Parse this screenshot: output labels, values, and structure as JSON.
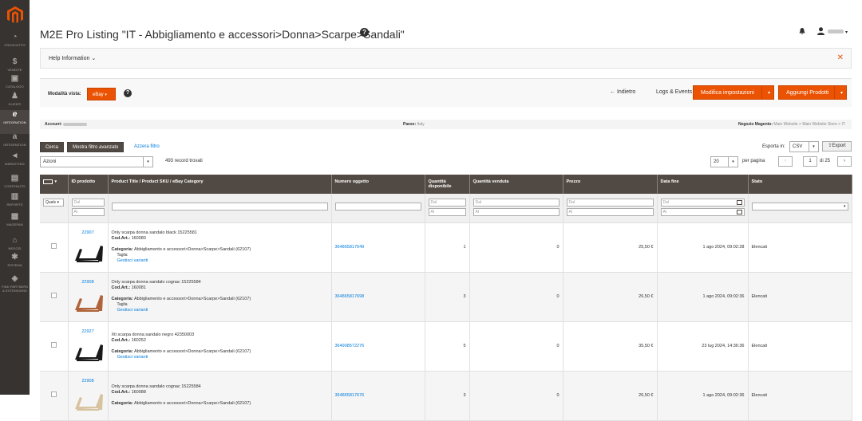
{
  "sidebar": {
    "items": [
      {
        "label": "CRUSCOTTO",
        "icon": "dashboard-icon"
      },
      {
        "label": "VENDITE",
        "icon": "dollar-icon"
      },
      {
        "label": "CATALOGO",
        "icon": "box-icon"
      },
      {
        "label": "CLIENTI",
        "icon": "person-icon"
      },
      {
        "label": "INTEGRATION",
        "icon": "ebay-icon"
      },
      {
        "label": "INTEGRATION",
        "icon": "amazon-icon"
      },
      {
        "label": "MARKETING",
        "icon": "megaphone-icon"
      },
      {
        "label": "CONTENUTO",
        "icon": "content-icon"
      },
      {
        "label": "REPORTS",
        "icon": "bar-chart-icon"
      },
      {
        "label": "MAGEFAN",
        "icon": "magefan-icon"
      },
      {
        "label": "NEGOZI",
        "icon": "store-icon"
      },
      {
        "label": "SISTEMA",
        "icon": "gear-icon"
      },
      {
        "label": "FIND PARTNERS & EXTENSIONS",
        "icon": "blocks-icon"
      }
    ],
    "logo_color": "#eb5202"
  },
  "header": {
    "title": "M2E Pro Listing \"IT - Abbigliamento e accessori>Donna>Scarpe>Sandali\"",
    "help_icon": "?"
  },
  "help_bar": {
    "label": "Help Information",
    "close": "✕"
  },
  "toolbar": {
    "mode_label": "Modalità vista:",
    "mode_value": "eBay",
    "back": "Indietro",
    "logs": "Logs & Events",
    "edit_settings": "Modifica impostazioni",
    "add_products": "Aggiungi Prodotti"
  },
  "info": {
    "account_label": "Account:",
    "country_label": "Paese:",
    "country_value": "Italy",
    "store_label": "Negozio Magento:",
    "store_value": "Main Website > Main Website Store > IT"
  },
  "grid_controls": {
    "search": "Cerca",
    "advanced_filter": "Mostra filtro avanzato",
    "reset_filter": "Azzera filtro",
    "export_label": "Esporta in:",
    "export_format": "CSV",
    "export_button": "Export",
    "actions": "Azioni",
    "records": "493 record trovati",
    "per_page_value": "20",
    "per_page_label": "per pagina",
    "page_current": "1",
    "page_total": "di 25"
  },
  "columns": [
    "ID prodotto",
    "Product Title / Product SKU / eBay Category",
    "Numero oggetto",
    "Quantità disponibile",
    "Quantità venduta",
    "Prezzo",
    "Data fine",
    "Stato"
  ],
  "filters": {
    "any": "Quals",
    "from": "Dal",
    "to": "Al"
  },
  "rows": [
    {
      "id": "22907",
      "title": "Only scarpa donna sandalo black 15225581",
      "sku_label": "Cod.Art.:",
      "sku": "160080",
      "category_label": "Categoria:",
      "category": "Abbigliamento e accessori>Donna>Scarpe>Sandali (62107)",
      "variation_label": "Taglia",
      "variations_link": "Gestisci varianti",
      "item_number": "364865817649",
      "qty_available": "1",
      "qty_sold": "0",
      "price": "25,50 €",
      "end_date": "1 ago 2024, 09:02:28",
      "status": "Elencati",
      "shoe_color": "#1a1a1a"
    },
    {
      "id": "22908",
      "title": "Only scarpa donna sandalo cognac 15225584",
      "sku_label": "Cod.Art.:",
      "sku": "160081",
      "category_label": "Categoria:",
      "category": "Abbigliamento e accessori>Donna>Scarpe>Sandali (62107)",
      "variation_label": "Taglia",
      "variations_link": "Gestisci varianti",
      "item_number": "364865817698",
      "qty_available": "3",
      "qty_sold": "0",
      "price": "26,50 €",
      "end_date": "1 ago 2024, 09:02:36",
      "status": "Elencati",
      "shoe_color": "#b0643a"
    },
    {
      "id": "22927",
      "title": "Xti scarpa donna sandalo negro 42350003",
      "sku_label": "Cod.Art.:",
      "sku": "160252",
      "category_label": "Categoria:",
      "category": "Abbigliamento e accessori>Donna>Scarpe>Sandali (62107)",
      "variation_label": "",
      "variations_link": "Gestisci varianti",
      "item_number": "364908572276",
      "qty_available": "5",
      "qty_sold": "0",
      "price": "35,50 €",
      "end_date": "23 lug 2024, 14:36:36",
      "status": "Elencati",
      "shoe_color": "#1a1a1a"
    },
    {
      "id": "22908",
      "title": "Only scarpa donna sandalo cognac 15225584",
      "sku_label": "Cod.Art.:",
      "sku": "160088",
      "category_label": "Categoria:",
      "category": "Abbigliamento e accessori>Donna>Scarpe>Sandali (62107)",
      "variation_label": "",
      "variations_link": "",
      "item_number": "364865817676",
      "qty_available": "3",
      "qty_sold": "0",
      "price": "26,50 €",
      "end_date": "1 ago 2024, 09:02:36",
      "status": "Elencati",
      "shoe_color": "#d8c3a0"
    }
  ]
}
